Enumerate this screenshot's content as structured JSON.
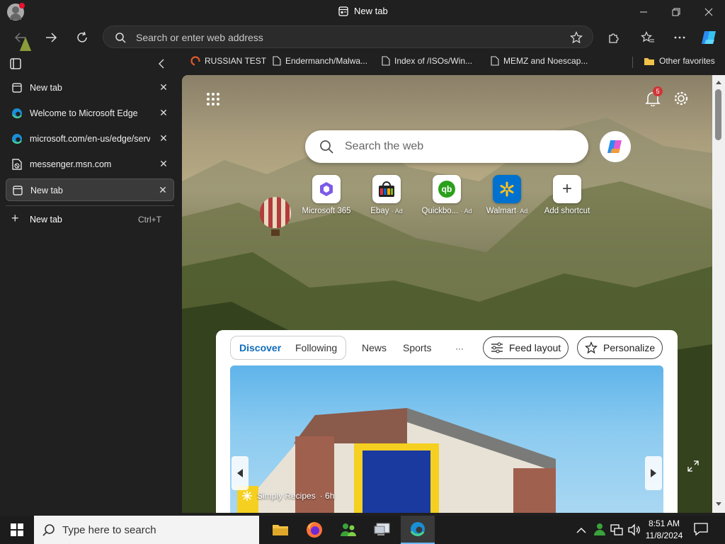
{
  "window": {
    "title": "New tab"
  },
  "address_bar": {
    "placeholder": "Search or enter web address"
  },
  "favorites": [
    {
      "label": "RUSSIAN TEST"
    },
    {
      "label": "Endermanch/Malwa..."
    },
    {
      "label": "Index of /ISOs/Win..."
    },
    {
      "label": "MEMZ and Noescap..."
    }
  ],
  "other_favorites": "Other favorites",
  "vertical_tabs": [
    {
      "label": "New tab"
    },
    {
      "label": "Welcome to Microsoft Edge"
    },
    {
      "label": "microsoft.com/en-us/edge/serve"
    },
    {
      "label": "messenger.msn.com"
    },
    {
      "label": "New tab"
    }
  ],
  "new_tab": {
    "label": "New tab",
    "shortcut": "Ctrl+T"
  },
  "newtab_page": {
    "search_placeholder": "Search the web",
    "notification_count": "5",
    "tiles": [
      {
        "label": "Microsoft 365",
        "ad": ""
      },
      {
        "label": "Ebay",
        "ad": "· Ad"
      },
      {
        "label": "Quickbo...",
        "ad": "· Ad"
      },
      {
        "label": "Walmart",
        "ad": "· Ad"
      },
      {
        "label": "Add shortcut",
        "ad": ""
      }
    ]
  },
  "feed": {
    "tabs": [
      "Discover",
      "Following",
      "News",
      "Sports",
      "···"
    ],
    "feed_layout": "Feed layout",
    "personalize": "Personalize",
    "source": "Simply Recipes",
    "age": "· 6h"
  },
  "taskbar": {
    "search_placeholder": "Type here to search",
    "time": "8:51 AM",
    "date": "11/8/2024"
  },
  "colors": {
    "accent": "#0f6cbd",
    "badge": "#d13438"
  }
}
